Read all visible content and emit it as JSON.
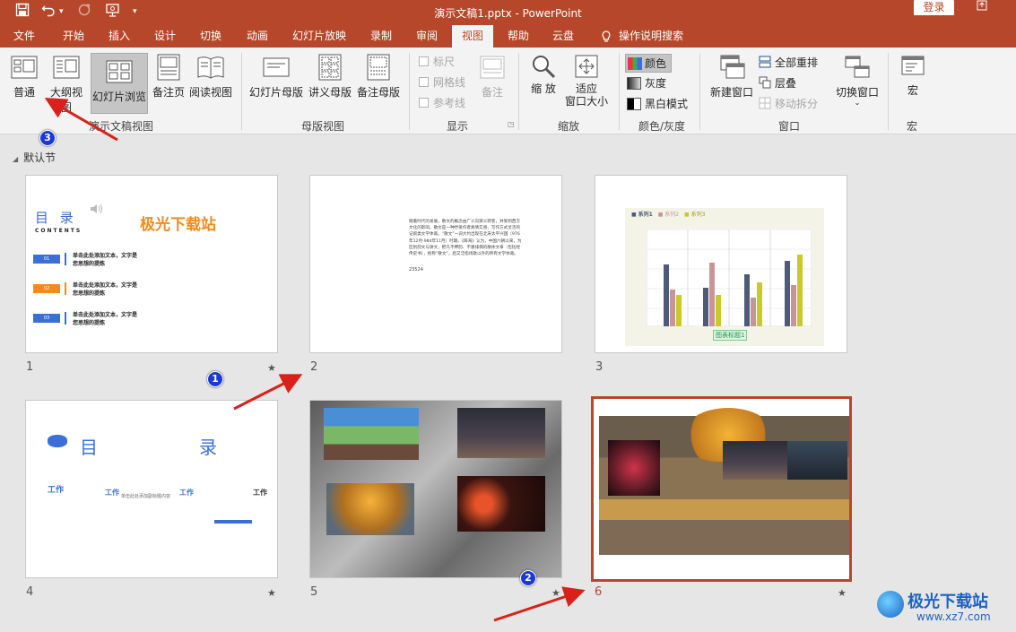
{
  "window": {
    "title": "演示文稿1.pptx  -  PowerPoint",
    "login_label": "登录"
  },
  "tabs": [
    {
      "label": "文件"
    },
    {
      "label": "开始"
    },
    {
      "label": "插入"
    },
    {
      "label": "设计"
    },
    {
      "label": "切换"
    },
    {
      "label": "动画"
    },
    {
      "label": "幻灯片放映"
    },
    {
      "label": "录制"
    },
    {
      "label": "审阅"
    },
    {
      "label": "视图"
    },
    {
      "label": "帮助"
    },
    {
      "label": "云盘"
    },
    {
      "label": "操作说明搜索"
    }
  ],
  "ribbon": {
    "presentation_views": {
      "label": "演示文稿视图",
      "buttons": [
        "普通",
        "大纲视图",
        "幻灯片浏览",
        "备注页",
        "阅读视图"
      ]
    },
    "master_views": {
      "label": "母版视图",
      "buttons": [
        "幻灯片母版",
        "讲义母版",
        "备注母版"
      ]
    },
    "show": {
      "label": "显示",
      "items": [
        "标尺",
        "网格线",
        "参考线"
      ],
      "notes": "备注"
    },
    "zoom": {
      "label": "缩放",
      "zoom_btn": "缩\n放",
      "fit_line1": "适应",
      "fit_line2": "窗口大小"
    },
    "color": {
      "label": "颜色/灰度",
      "items": [
        "颜色",
        "灰度",
        "黑白模式"
      ]
    },
    "window": {
      "label": "窗口",
      "new_window": "新建窗口",
      "arrange_all": "全部重排",
      "cascade": "层叠",
      "move_split": "移动拆分",
      "switch": "切换窗口"
    },
    "macro": {
      "label": "宏",
      "btn": "宏"
    }
  },
  "section": {
    "label": "默认节"
  },
  "slides": [
    {
      "number": "1"
    },
    {
      "number": "2"
    },
    {
      "number": "3"
    },
    {
      "number": "4"
    },
    {
      "number": "5"
    },
    {
      "number": "6"
    }
  ],
  "slide1": {
    "title": "目 录",
    "subtitle": "CONTENTS",
    "brand": "极光下载站",
    "rows": [
      {
        "num": "01",
        "text": "单击此处添加文本，文字是\n您思想的提炼"
      },
      {
        "num": "02",
        "text": "单击此处添加文本，文字是\n您思想的提炼"
      },
      {
        "num": "03",
        "text": "单击此处添加文本，文字是\n您思想的提炼"
      }
    ]
  },
  "slide2": {
    "text": "随着时代的发展，散文的概念由广义向狭义转变，并受到西方文化的影响。散文是一种抒发作者真情实感、写作方式灵活的记叙类文学体裁。“散文”一词大约出现在北宋太平兴国（976年12月-984年11月）时期。《辞海》认为，中国六朝以来，为区别韵文与骈文，把凡不押韵、不重排偶的散体文章（包括经传史书），统称“散文”，后又泛指诗歌以外的所有文学体裁。",
    "footer": "23524"
  },
  "slide3": {
    "legend": [
      "系列1",
      "系列2",
      "系列3"
    ],
    "chart_title": "图表标题1"
  },
  "slide4": {
    "title_left": "目",
    "title_right": "录",
    "items": [
      "工作",
      "工作",
      "工作",
      "工作"
    ],
    "line": "单击此处添加副标题内容"
  },
  "badges": [
    "1",
    "2",
    "3"
  ],
  "watermark": {
    "name": "极光下载站",
    "url": "www.xz7.com"
  },
  "colors": {
    "accent": "#b7472a",
    "badge": "#1b39d4",
    "arrow": "#d9211b"
  }
}
